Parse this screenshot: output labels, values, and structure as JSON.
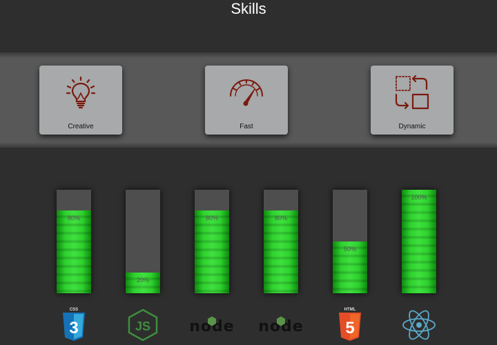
{
  "header": {
    "title": "Skills"
  },
  "features": [
    {
      "label": "Creative",
      "icon": "lightbulb-icon"
    },
    {
      "label": "Fast",
      "icon": "speedometer-icon"
    },
    {
      "label": "Dynamic",
      "icon": "transform-icon"
    }
  ],
  "skills": [
    {
      "label": "80%",
      "percent": 80,
      "icon": "css3-icon",
      "badge": "CSS",
      "glyph": "3"
    },
    {
      "label": "20%",
      "percent": 20,
      "icon": "nodejs-js-icon",
      "glyph": "JS"
    },
    {
      "label": "80%",
      "percent": 80,
      "icon": "node-logo-icon",
      "text": "node"
    },
    {
      "label": "80%",
      "percent": 80,
      "icon": "node-logo-icon",
      "text": "node"
    },
    {
      "label": "50%",
      "percent": 50,
      "icon": "html5-icon",
      "badge": "HTML",
      "glyph": "5"
    },
    {
      "label": "100%",
      "percent": 100,
      "icon": "react-icon"
    }
  ],
  "colors": {
    "accent": "#7a1a0e",
    "bar_fill": "#2ed12e",
    "card": "#a7a9aa",
    "css3": "#2a8ad8",
    "html5": "#e84e25",
    "react": "#5aa9c9",
    "js_green": "#3e8e3e"
  }
}
